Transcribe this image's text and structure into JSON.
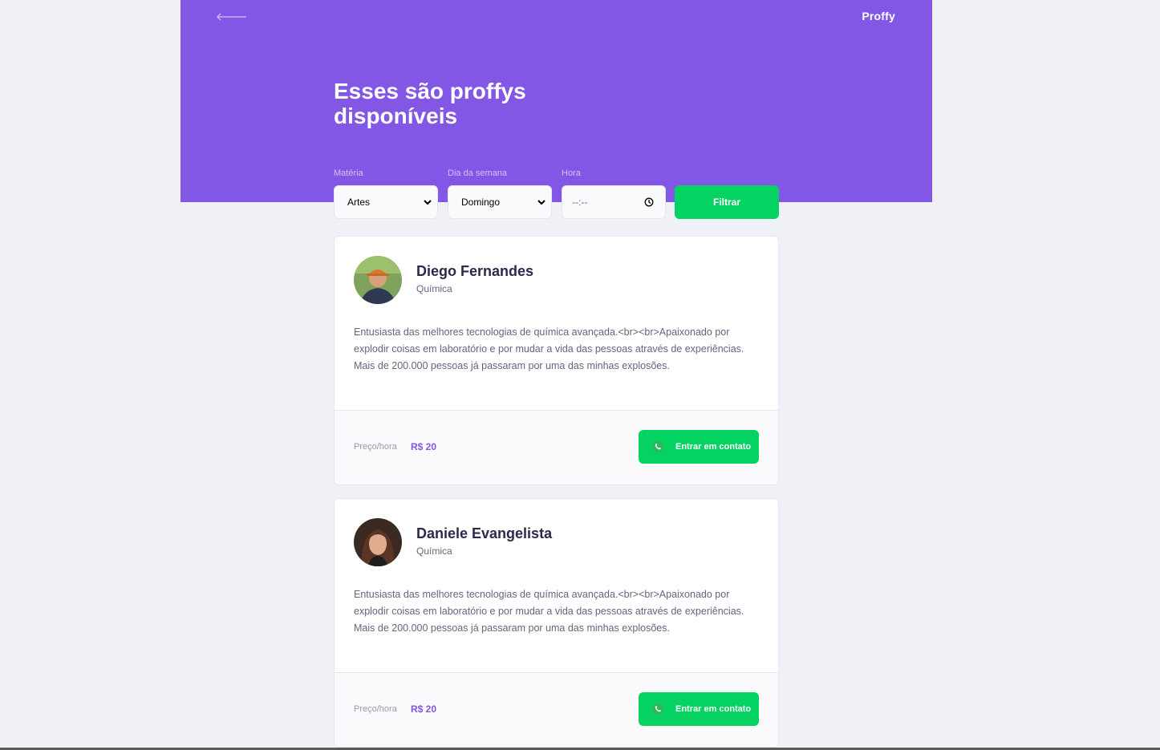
{
  "header": {
    "logo": "Proffy",
    "title": "Esses são proffys disponíveis"
  },
  "filters": {
    "subject": {
      "label": "Matéria",
      "value": "Artes"
    },
    "weekday": {
      "label": "Dia da semana",
      "value": "Domingo"
    },
    "time": {
      "label": "Hora",
      "value": "--:--"
    },
    "submit_label": "Filtrar"
  },
  "teachers": [
    {
      "name": "Diego Fernandes",
      "subject": "Química",
      "bio": "Entusiasta das melhores tecnologias de química avançada.<br><br>Apaixonado por explodir coisas em laboratório e por mudar a vida das pessoas através de experiências. Mais de 200.000 pessoas já passaram por uma das minhas explosões.",
      "price_label": "Preço/hora",
      "price": "R$ 20",
      "contact_label": "Entrar em contato"
    },
    {
      "name": "Daniele Evangelista",
      "subject": "Química",
      "bio": "Entusiasta das melhores tecnologias de química avançada.<br><br>Apaixonado por explodir coisas em laboratório e por mudar a vida das pessoas através de experiências. Mais de 200.000 pessoas já passaram por uma das minhas explosões.",
      "price_label": "Preço/hora",
      "price": "R$ 20",
      "contact_label": "Entrar em contato"
    }
  ],
  "colors": {
    "primary": "#8257e5",
    "secondary": "#04d361",
    "background": "#f0f0f7",
    "title_text": "#32264d",
    "body_text": "#6a6180"
  },
  "icons": {
    "back": "arrow-left-icon",
    "select": "chevron-down-icon",
    "time": "clock-icon",
    "contact": "whatsapp-icon"
  }
}
